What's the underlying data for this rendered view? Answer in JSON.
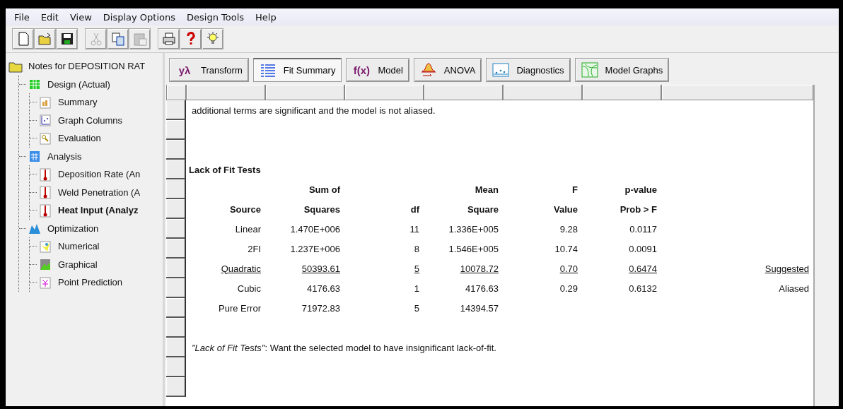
{
  "menu": [
    "File",
    "Edit",
    "View",
    "Display Options",
    "Design Tools",
    "Help"
  ],
  "toolbar": [
    {
      "kind": "new",
      "disabled": false
    },
    {
      "kind": "open",
      "disabled": false
    },
    {
      "kind": "save",
      "disabled": false
    },
    {
      "kind": "sep"
    },
    {
      "kind": "cut",
      "disabled": true
    },
    {
      "kind": "copy",
      "disabled": false
    },
    {
      "kind": "paste",
      "disabled": true
    },
    {
      "kind": "sep"
    },
    {
      "kind": "print",
      "disabled": false
    },
    {
      "kind": "help",
      "disabled": false
    },
    {
      "kind": "tip",
      "disabled": false
    }
  ],
  "sidebar": {
    "root": {
      "label": "Notes for DEPOSITION RAT",
      "kind": "folder",
      "selected": false,
      "children": [
        {
          "label": "Design (Actual)",
          "kind": "sheet",
          "selected": false,
          "children": [
            {
              "label": "Summary",
              "kind": "summary",
              "selected": false
            },
            {
              "label": "Graph Columns",
              "kind": "graph",
              "selected": false
            },
            {
              "label": "Evaluation",
              "kind": "eval",
              "selected": false
            }
          ]
        },
        {
          "label": "Analysis",
          "kind": "calc",
          "selected": false,
          "children": [
            {
              "label": "Deposition Rate (An",
              "kind": "thermo",
              "selected": false
            },
            {
              "label": "Weld Penetration (A",
              "kind": "thermo",
              "selected": false
            },
            {
              "label": "Heat Input (Analyz",
              "kind": "thermo",
              "selected": true
            }
          ]
        },
        {
          "label": "Optimization",
          "kind": "opt",
          "selected": false,
          "children": [
            {
              "label": "Numerical",
              "kind": "num",
              "selected": false
            },
            {
              "label": "Graphical",
              "kind": "graphical",
              "selected": false
            },
            {
              "label": "Point Prediction",
              "kind": "point",
              "selected": false
            }
          ]
        }
      ]
    }
  },
  "tabs": [
    {
      "label": "Transform",
      "kind": "glyph",
      "glyph": "yλ",
      "selected": false
    },
    {
      "label": "Fit Summary",
      "kind": "list",
      "selected": true
    },
    {
      "label": "Model",
      "kind": "glyph",
      "glyph": "f(x)",
      "selected": false
    },
    {
      "label": "ANOVA",
      "kind": "curve",
      "selected": false
    },
    {
      "label": "Diagnostics",
      "kind": "scatter",
      "selected": false
    },
    {
      "label": "Model Graphs",
      "kind": "contour",
      "selected": false
    }
  ],
  "report": {
    "rows": [
      {
        "kind": "text",
        "text": "additional terms are significant and the model is not aliased."
      },
      {
        "kind": "blank"
      },
      {
        "kind": "blank"
      },
      {
        "kind": "title",
        "text": "Lack of Fit Tests"
      },
      {
        "kind": "header",
        "cells": [
          "",
          "Sum of",
          "",
          "Mean",
          "F",
          "p-value",
          ""
        ]
      },
      {
        "kind": "header",
        "cells": [
          "Source",
          "Squares",
          "df",
          "Square",
          "Value",
          "Prob > F",
          ""
        ]
      },
      {
        "kind": "data",
        "underlined": false,
        "cells": [
          "Linear",
          "1.470E+006",
          "11",
          "1.336E+005",
          "9.28",
          "0.0117",
          ""
        ]
      },
      {
        "kind": "data",
        "underlined": false,
        "cells": [
          "2FI",
          "1.237E+006",
          "8",
          "1.546E+005",
          "10.74",
          "0.0091",
          ""
        ]
      },
      {
        "kind": "data",
        "underlined": true,
        "cells": [
          "Quadratic",
          "50393.61",
          "5",
          "10078.72",
          "0.70",
          "0.6474",
          "Suggested"
        ]
      },
      {
        "kind": "data",
        "underlined": false,
        "cells": [
          "Cubic",
          "4176.63",
          "1",
          "4176.63",
          "0.29",
          "0.6132",
          "Aliased"
        ]
      },
      {
        "kind": "data",
        "underlined": false,
        "cells": [
          "Pure Error",
          "71972.83",
          "5",
          "14394.57",
          "",
          "",
          ""
        ]
      },
      {
        "kind": "blank"
      },
      {
        "kind": "text",
        "text": "*\"Lack of Fit Tests\"*:  Want the selected model to have insignificant lack-of-fit."
      },
      {
        "kind": "blank"
      },
      {
        "kind": "blank"
      }
    ]
  }
}
